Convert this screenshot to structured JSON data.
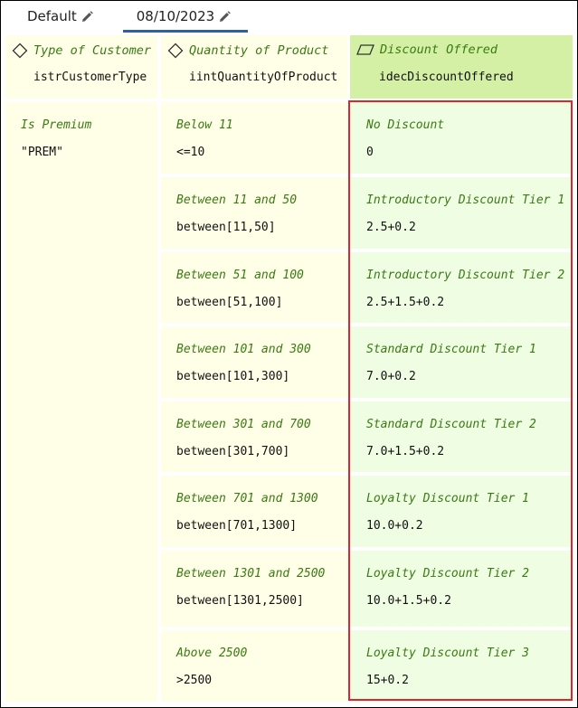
{
  "tabs": [
    {
      "label": "Default",
      "active": false
    },
    {
      "label": "08/10/2023",
      "active": true
    }
  ],
  "headers": [
    {
      "title": "Type of Customer",
      "field": "istrCustomerType",
      "icon": "diamond-icon"
    },
    {
      "title": "Quantity of Product",
      "field": "iintQuantityOfProduct",
      "icon": "diamond-icon"
    },
    {
      "title": "Discount Offered",
      "field": "idecDiscountOffered",
      "icon": "parallelogram-icon"
    }
  ],
  "customer_type": {
    "label": "Is Premium",
    "expr": "\"PREM\""
  },
  "rows": [
    {
      "qty_label": "Below 11",
      "qty_expr": "<=10",
      "disc_label": "No Discount",
      "disc_expr": "0"
    },
    {
      "qty_label": "Between 11 and 50",
      "qty_expr": "between[11,50]",
      "disc_label": "Introductory Discount Tier 1",
      "disc_expr": "2.5+0.2"
    },
    {
      "qty_label": "Between 51 and 100",
      "qty_expr": "between[51,100]",
      "disc_label": "Introductory Discount Tier 2",
      "disc_expr": "2.5+1.5+0.2"
    },
    {
      "qty_label": "Between 101 and 300",
      "qty_expr": "between[101,300]",
      "disc_label": "Standard Discount Tier 1",
      "disc_expr": "7.0+0.2"
    },
    {
      "qty_label": "Between 301 and 700",
      "qty_expr": "between[301,700]",
      "disc_label": "Standard Discount Tier 2",
      "disc_expr": "7.0+1.5+0.2"
    },
    {
      "qty_label": "Between 701 and 1300",
      "qty_expr": "between[701,1300]",
      "disc_label": "Loyalty Discount Tier 1",
      "disc_expr": "10.0+0.2"
    },
    {
      "qty_label": "Between 1301 and 2500",
      "qty_expr": "between[1301,2500]",
      "disc_label": "Loyalty Discount Tier 2",
      "disc_expr": "10.0+1.5+0.2"
    },
    {
      "qty_label": "Above 2500",
      "qty_expr": ">2500",
      "disc_label": "Loyalty Discount Tier 3",
      "disc_expr": "15+0.2"
    }
  ],
  "colors": {
    "label_green": "#3a7a12",
    "cond_bg": "#ffffe7",
    "result_header_bg": "#d4f0a4",
    "result_bg": "#effde3",
    "highlight": "#e0242b",
    "tab_underline": "#2f5fa8"
  }
}
